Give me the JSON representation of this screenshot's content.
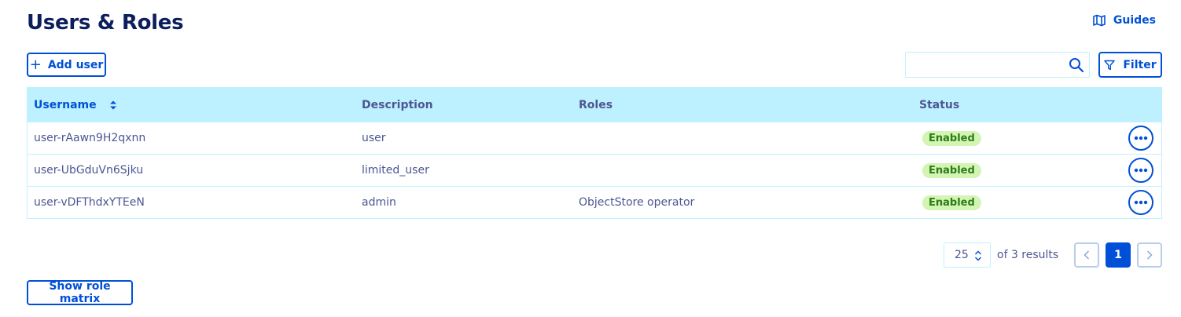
{
  "header": {
    "title": "Users & Roles",
    "guides_label": "Guides"
  },
  "toolbar": {
    "add_user_label": "Add user",
    "search_value": "",
    "search_placeholder": "",
    "filter_label": "Filter"
  },
  "table": {
    "columns": [
      "Username",
      "Description",
      "Roles",
      "Status"
    ],
    "rows": [
      {
        "username": "user-rAawn9H2qxnn",
        "description": "user",
        "roles": "",
        "status": "Enabled"
      },
      {
        "username": "user-UbGduVn6Sjku",
        "description": "limited_user",
        "roles": "",
        "status": "Enabled"
      },
      {
        "username": "user-vDFThdxYTEeN",
        "description": "admin",
        "roles": "ObjectStore operator",
        "status": "Enabled"
      }
    ]
  },
  "pagination": {
    "page_size": "25",
    "results_text": "of 3 results",
    "current_page": "1"
  },
  "footer": {
    "role_matrix_label": "Show role matrix"
  },
  "colors": {
    "accent": "#0050d7",
    "header_bg": "#bef1ff",
    "title": "#0c1e5b",
    "text": "#4d5693",
    "badge_bg": "#d4f4b6",
    "badge_text": "#2b7e14"
  },
  "icons": {
    "guides": "book-map-icon",
    "add": "plus-icon",
    "search": "search-icon",
    "filter": "funnel-icon",
    "sort": "sort-icon",
    "row_menu": "more-horizontal-icon",
    "prev": "chevron-left-icon",
    "next": "chevron-right-icon",
    "page_size": "up-down-chevron-icon"
  }
}
